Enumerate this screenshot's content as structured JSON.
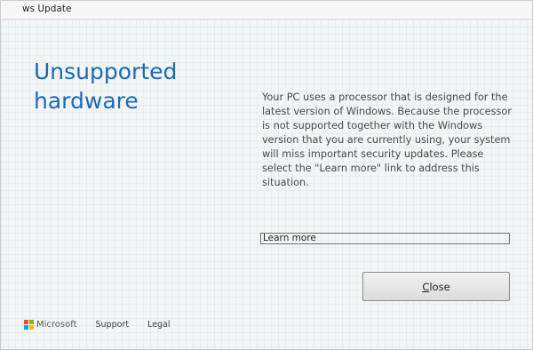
{
  "window": {
    "title": "ws Update"
  },
  "main": {
    "heading": "Unsupported hardware",
    "message": "Your PC uses a processor that is designed for the latest version of Windows. Because the processor is not supported together with the Windows version that you are currently using, your system will miss important security updates. Please select the \"Learn more\" link to address this situation.",
    "learn_more_link": "Learn more",
    "close_button": {
      "mnemonic": "C",
      "rest": "lose"
    }
  },
  "footer": {
    "brand": "Microsoft",
    "links": [
      "Support",
      "Legal"
    ]
  },
  "colors": {
    "heading": "#1c6ab4",
    "ms_logo": [
      "#f25022",
      "#7fba00",
      "#00a4ef",
      "#ffb900"
    ]
  }
}
